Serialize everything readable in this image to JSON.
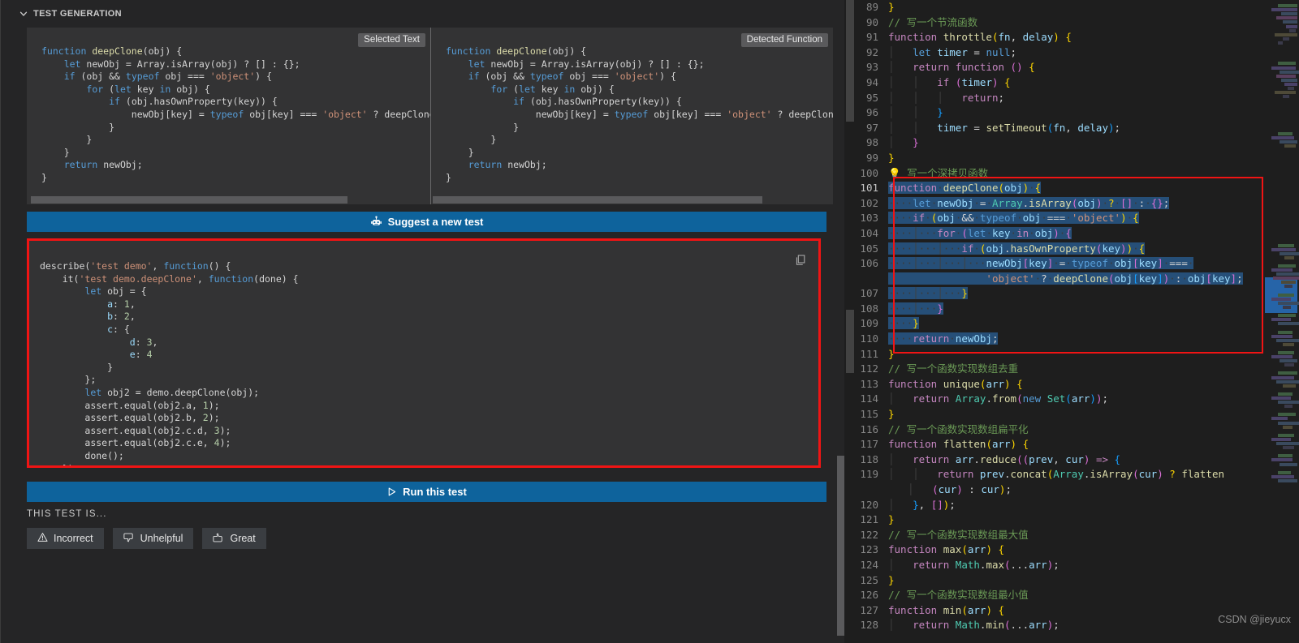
{
  "section": {
    "title": "TEST GENERATION",
    "chevron_icon": "chevron-down-icon"
  },
  "preview": {
    "left_badge": "Selected Text",
    "right_badge": "Detected Function",
    "left_code": "function deepClone(obj) {\n    let newObj = Array.isArray(obj) ? [] : {};\n    if (obj && typeof obj === 'object') {\n        for (let key in obj) {\n            if (obj.hasOwnProperty(key)) {\n                newObj[key] = typeof obj[key] === 'object' ? deepClone(obj\n            }\n        }\n    }\n    return newObj;\n}",
    "right_code": "function deepClone(obj) {\n    let newObj = Array.isArray(obj) ? [] : {};\n    if (obj && typeof obj === 'object') {\n        for (let key in obj) {\n            if (obj.hasOwnProperty(key)) {\n                newObj[key] = typeof obj[key] === 'object' ? deepClone(obj\n            }\n        }\n    }\n    return newObj;\n}"
  },
  "actions": {
    "suggest_label": "Suggest a new test",
    "suggest_icon": "robot-icon",
    "run_label": "Run this test",
    "run_icon": "play-icon",
    "copy_icon": "copy-icon"
  },
  "generated_test": {
    "code": "describe('test demo', function() {\n    it('test demo.deepClone', function(done) {\n        let obj = {\n            a: 1,\n            b: 2,\n            c: {\n                d: 3,\n                e: 4\n            }\n        };\n        let obj2 = demo.deepClone(obj);\n        assert.equal(obj2.a, 1);\n        assert.equal(obj2.b, 2);\n        assert.equal(obj2.c.d, 3);\n        assert.equal(obj2.c.e, 4);\n        done();\n    })"
  },
  "feedback": {
    "prompt": "THIS TEST IS...",
    "buttons": [
      {
        "label": "Incorrect",
        "icon": "warning-triangle-icon"
      },
      {
        "label": "Unhelpful",
        "icon": "thumbs-down-icon"
      },
      {
        "label": "Great",
        "icon": "thumbs-up-icon"
      }
    ]
  },
  "editor": {
    "first_line": 89,
    "current_line": 101,
    "watermark": "CSDN @jieyucx",
    "lines": [
      {
        "n": 89,
        "text": "}"
      },
      {
        "n": 90,
        "text": "// 写一个节流函数"
      },
      {
        "n": 91,
        "text": "function throttle(fn, delay) {"
      },
      {
        "n": 92,
        "text": "    let timer = null;"
      },
      {
        "n": 93,
        "text": "    return function () {"
      },
      {
        "n": 94,
        "text": "        if (timer) {"
      },
      {
        "n": 95,
        "text": "            return;"
      },
      {
        "n": 96,
        "text": "        }"
      },
      {
        "n": 97,
        "text": "        timer = setTimeout(fn, delay);"
      },
      {
        "n": 98,
        "text": "    }"
      },
      {
        "n": 99,
        "text": "}"
      },
      {
        "n": 100,
        "text": "💡 写一个深拷贝函数"
      },
      {
        "n": 101,
        "text": "function deepClone(obj) {"
      },
      {
        "n": 102,
        "text": "    let newObj = Array.isArray(obj) ? [] : {};"
      },
      {
        "n": 103,
        "text": "    if (obj && typeof obj === 'object') {"
      },
      {
        "n": 104,
        "text": "        for (let key in obj) {"
      },
      {
        "n": 105,
        "text": "            if (obj.hasOwnProperty(key)) {"
      },
      {
        "n": 106,
        "text": "                newObj[key] = typeof obj[key] === 'object' ? deepClone(obj[key]) : obj[key];"
      },
      {
        "n": 107,
        "text": "            }"
      },
      {
        "n": 108,
        "text": "        }"
      },
      {
        "n": 109,
        "text": "    }"
      },
      {
        "n": 110,
        "text": "    return newObj;"
      },
      {
        "n": 111,
        "text": "}"
      },
      {
        "n": 112,
        "text": "// 写一个函数实现数组去重"
      },
      {
        "n": 113,
        "text": "function unique(arr) {"
      },
      {
        "n": 114,
        "text": "    return Array.from(new Set(arr));"
      },
      {
        "n": 115,
        "text": "}"
      },
      {
        "n": 116,
        "text": "// 写一个函数实现数组扁平化"
      },
      {
        "n": 117,
        "text": "function flatten(arr) {"
      },
      {
        "n": 118,
        "text": "    return arr.reduce((prev, cur) => {"
      },
      {
        "n": 119,
        "text": "        return prev.concat(Array.isArray(cur) ? flatten(cur) : cur);"
      },
      {
        "n": 120,
        "text": "    }, []);"
      },
      {
        "n": 121,
        "text": "}"
      },
      {
        "n": 122,
        "text": "// 写一个函数实现数组最大值"
      },
      {
        "n": 123,
        "text": "function max(arr) {"
      },
      {
        "n": 124,
        "text": "    return Math.max(...arr);"
      },
      {
        "n": 125,
        "text": "}"
      },
      {
        "n": 126,
        "text": "// 写一个函数实现数组最小值"
      },
      {
        "n": 127,
        "text": "function min(arr) {"
      },
      {
        "n": 128,
        "text": "    return Math.min(...arr);"
      }
    ]
  },
  "colors": {
    "accent_blue": "#0e639c",
    "highlight_red": "#f01414",
    "panel_bg": "#252526",
    "code_bg": "#333334",
    "editor_bg": "#1e1e1e",
    "selection": "#264f78"
  }
}
